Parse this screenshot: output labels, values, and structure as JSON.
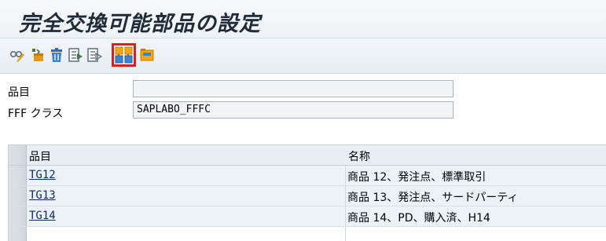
{
  "title": "完全交換可能部品の設定",
  "toolbar": {
    "icons": [
      {
        "name": "display-change-icon"
      },
      {
        "name": "new-entries-icon"
      },
      {
        "name": "delete-icon"
      },
      {
        "name": "select-all-icon"
      },
      {
        "name": "deselect-icon"
      },
      {
        "name": "configuration-icon",
        "highlighted": true
      },
      {
        "name": "save-variant-icon"
      }
    ],
    "highlight_color": "#e01b22"
  },
  "form": {
    "material_label": "品目",
    "material_value": "",
    "fff_class_label": "FFF クラス",
    "fff_class_value": "SAPLABO_FFFC"
  },
  "table": {
    "columns": [
      "品目",
      "名称"
    ],
    "rows": [
      {
        "code": "TG12",
        "name": "商品 12、発注点、標準取引"
      },
      {
        "code": "TG13",
        "name": "商品 13、発注点、サードパーティ"
      },
      {
        "code": "TG14",
        "name": "商品 14、PD、購入済、H14"
      }
    ]
  },
  "colors": {
    "link": "#0d2b66",
    "header_bg": "#e9eef2",
    "row_bg": "#edf2f7"
  }
}
